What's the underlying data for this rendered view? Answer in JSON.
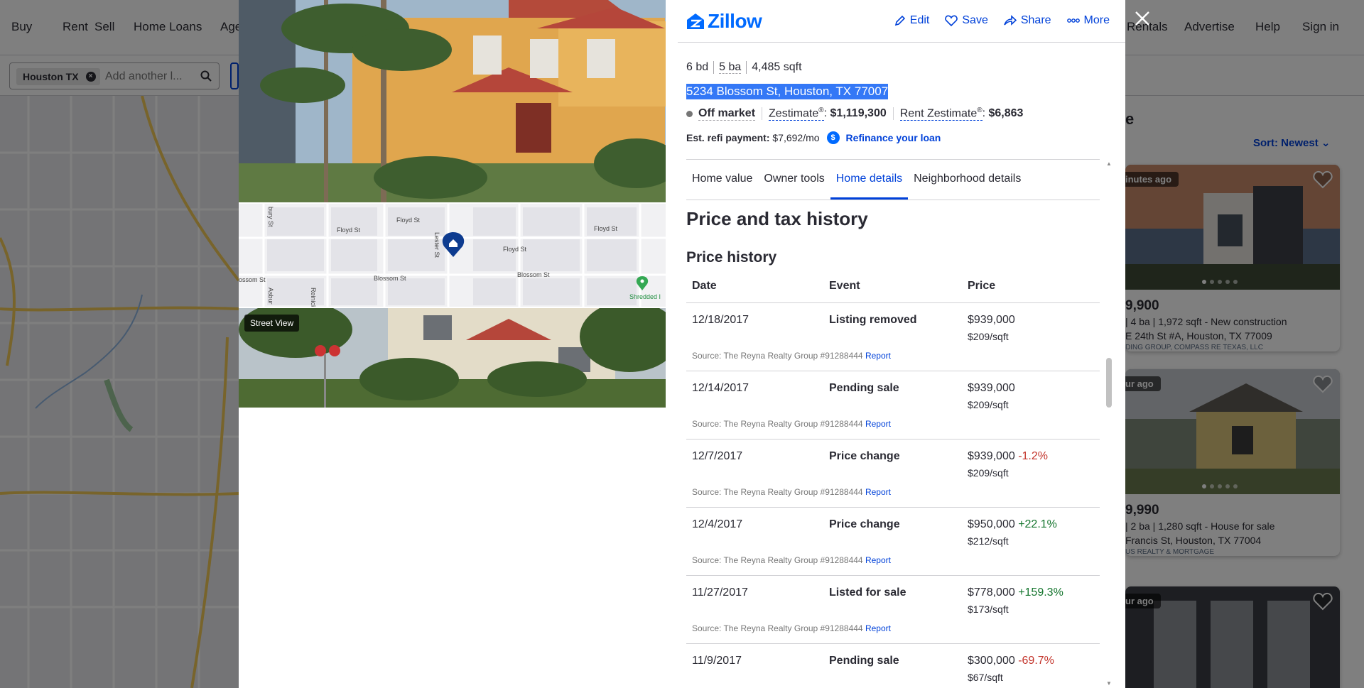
{
  "nav": {
    "buy": "Buy",
    "rent": "Rent",
    "sell": "Sell",
    "home_loans": "Home Loans",
    "agent": "Age",
    "rentals": "Rentals",
    "advertise": "Advertise",
    "help": "Help",
    "sign_in": "Sign in"
  },
  "search": {
    "chip_label": "Houston TX",
    "placeholder": "Add another l..."
  },
  "listings": {
    "heading": "e",
    "sort_label": "Sort: Newest",
    "cards": [
      {
        "badge": "inutes ago",
        "price": "9,900",
        "facts_beds": "| 4 ba | 1,972 sqft - New construction",
        "address": "E 24th St #A, Houston, TX 77009",
        "broker": "ding Group, COMPASS RE TEXAS, LLC"
      },
      {
        "badge": "ur ago",
        "price": "9,990",
        "facts_beds": "| 2 ba | 1,280 sqft - House for sale",
        "address": "Francis St, Houston, TX 77004",
        "broker": "US REALTY & MORTGAGE"
      },
      {
        "badge": "ur ago"
      }
    ]
  },
  "modal": {
    "logo": "Zillow",
    "actions": {
      "edit": "Edit",
      "save": "Save",
      "share": "Share",
      "more": "More"
    },
    "street_view_label": "Street View",
    "map_labels": [
      "Floyd St",
      "Floyd St",
      "Floyd St",
      "Floyd St",
      "Blossom St",
      "Blossom St",
      "ossom St",
      "Lester St",
      "bury St",
      "Asbur",
      "Reinick",
      "Shredded I"
    ],
    "facts": {
      "beds": "6 bd",
      "baths": "5 ba",
      "sqft": "4,485 sqft"
    },
    "address": "5234 Blossom St, Houston, TX 77007",
    "status": "Off market",
    "zestimate_label": "Zestimate",
    "zestimate_value": "$1,119,300",
    "rent_zestimate_label": "Rent Zestimate",
    "rent_zestimate_value": "$6,863",
    "reg_mark": "®",
    "refi_label": "Est. refi payment:",
    "refi_value": "$7,692/mo",
    "refi_link": "Refinance your loan",
    "tabs": [
      "Home value",
      "Owner tools",
      "Home details",
      "Neighborhood details"
    ],
    "active_tab": "Home details",
    "section_title": "Price and tax history",
    "subsection_title": "Price history",
    "table_headers": {
      "date": "Date",
      "event": "Event",
      "price": "Price"
    },
    "price_history": [
      {
        "date": "12/18/2017",
        "event": "Listing removed",
        "price": "$939,000",
        "change": "",
        "change_type": "",
        "psf": "$209/sqft",
        "source": "Source: The Reyna Realty Group #91288444",
        "report": "Report"
      },
      {
        "date": "12/14/2017",
        "event": "Pending sale",
        "price": "$939,000",
        "change": "",
        "change_type": "",
        "psf": "$209/sqft",
        "source": "Source: The Reyna Realty Group #91288444",
        "report": "Report"
      },
      {
        "date": "12/7/2017",
        "event": "Price change",
        "price": "$939,000",
        "change": "-1.2%",
        "change_type": "neg",
        "psf": "$209/sqft",
        "source": "Source: The Reyna Realty Group #91288444",
        "report": "Report"
      },
      {
        "date": "12/4/2017",
        "event": "Price change",
        "price": "$950,000",
        "change": "+22.1%",
        "change_type": "pos",
        "psf": "$212/sqft",
        "source": "Source: The Reyna Realty Group #91288444",
        "report": "Report"
      },
      {
        "date": "11/27/2017",
        "event": "Listed for sale",
        "price": "$778,000",
        "change": "+159.3%",
        "change_type": "pos",
        "psf": "$173/sqft",
        "source": "Source: The Reyna Realty Group #91288444",
        "report": "Report"
      },
      {
        "date": "11/9/2017",
        "event": "Pending sale",
        "price": "$300,000",
        "change": "-69.7%",
        "change_type": "neg",
        "psf": "$67/sqft",
        "source": "",
        "report": ""
      }
    ]
  },
  "colors": {
    "brand": "#006aff",
    "link": "#0041d9",
    "positive": "#14752d",
    "negative": "#c3342b",
    "selection": "#3478f6"
  }
}
